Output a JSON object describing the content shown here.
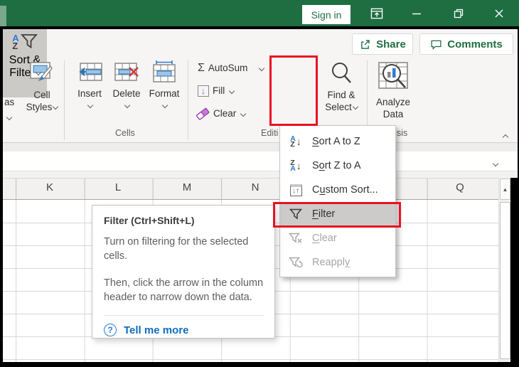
{
  "colors": {
    "excel_green": "#1E6E42",
    "accent_blue": "#2B7CD3",
    "link_blue": "#0F6CBD",
    "annotation_red": "#E81123",
    "sort_filter_pressed_bg": "#CCCAC7",
    "disabled_text": "#A8A6A4"
  },
  "title_bar": {
    "sign_in_label": "Sign in"
  },
  "ribbon": {
    "share_label": "Share",
    "comments_label": "Comments",
    "styles_group": {
      "format_as_table_visible": "as",
      "cell_styles_line1": "Cell",
      "cell_styles_line2": "Styles"
    },
    "cells_group": {
      "group_label": "Cells",
      "insert_label": "Insert",
      "delete_label": "Delete",
      "format_label": "Format"
    },
    "editing_group": {
      "group_label_visible": "Editi",
      "autosum_label": "AutoSum",
      "fill_label": "Fill",
      "clear_label": "Clear",
      "sort_filter_line1": "Sort &",
      "sort_filter_line2": "Filter",
      "find_select_line1": "Find &",
      "find_select_line2": "Select"
    },
    "analysis_group": {
      "group_label_visible": "sis",
      "analyze_line1": "Analyze",
      "analyze_line2": "Data"
    }
  },
  "icons": {
    "sigma": "Σ",
    "down_arrow": "↓",
    "up_arrow": "↑",
    "scroll_up_arrow": "▲",
    "question_mark": "?",
    "letter_a": "A",
    "letter_z": "Z"
  },
  "dropdown_menu": {
    "items": [
      {
        "pre": "",
        "accel": "S",
        "post": "ort A to Z",
        "state": "enabled"
      },
      {
        "pre": "S",
        "accel": "o",
        "post": "rt Z to A",
        "state": "enabled"
      },
      {
        "pre": "C",
        "accel": "u",
        "post": "stom Sort...",
        "state": "enabled"
      },
      {
        "pre": "",
        "accel": "F",
        "post": "ilter",
        "state": "highlighted"
      },
      {
        "pre": "",
        "accel": "C",
        "post": "lear",
        "state": "disabled"
      },
      {
        "pre": "Reappl",
        "accel": "y",
        "post": "",
        "state": "disabled"
      }
    ]
  },
  "tooltip": {
    "title": "Filter (Ctrl+Shift+L)",
    "paragraph1": "Turn on filtering for the selected cells.",
    "paragraph2": "Then, click the arrow in the column header to narrow down the data.",
    "link_label": "Tell me more"
  },
  "grid": {
    "column_headers": [
      "K",
      "L",
      "M",
      "N",
      "Q"
    ]
  }
}
